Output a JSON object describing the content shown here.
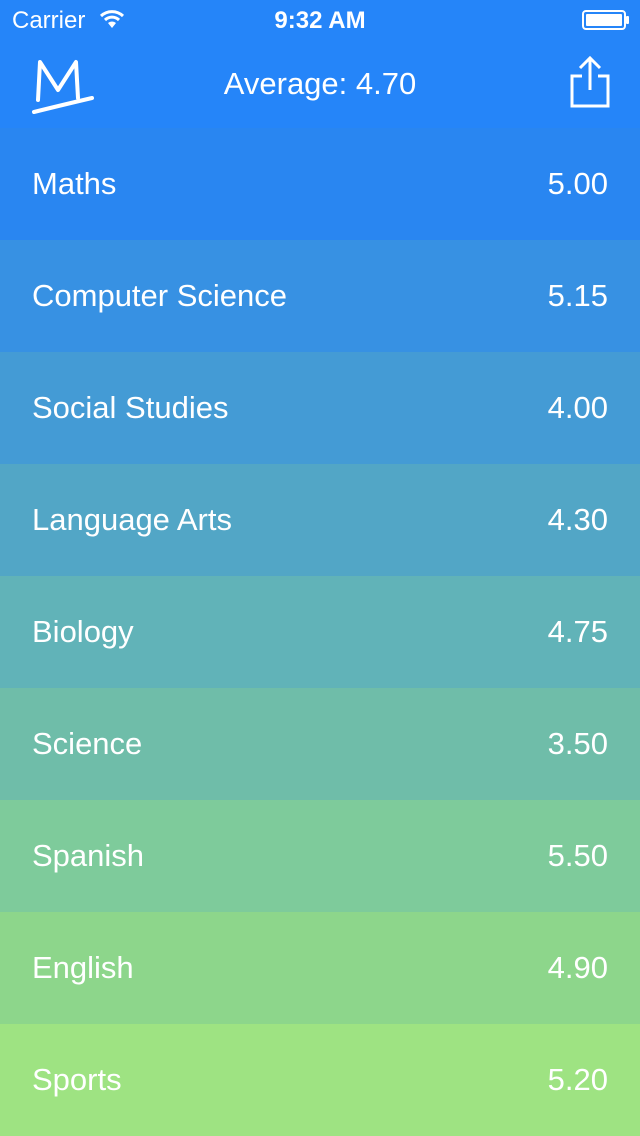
{
  "status_bar": {
    "carrier": "Carrier",
    "time": "9:32 AM",
    "wifi_icon": "wifi-icon",
    "battery_icon": "battery-icon"
  },
  "nav": {
    "logo_icon": "m-logo-icon",
    "average_text": "Average: 4.70",
    "share_icon": "share-icon"
  },
  "colors": {
    "header": "#2585f9",
    "rows": [
      "#2986f1",
      "#3791e3",
      "#449bd5",
      "#52a6c6",
      "#61b3b8",
      "#6fbda9",
      "#7ecb9b",
      "#8dd68b",
      "#9ee382"
    ]
  },
  "subjects": [
    {
      "name": "Maths",
      "grade": "5.00"
    },
    {
      "name": "Computer Science",
      "grade": "5.15"
    },
    {
      "name": "Social Studies",
      "grade": "4.00"
    },
    {
      "name": "Language Arts",
      "grade": "4.30"
    },
    {
      "name": "Biology",
      "grade": "4.75"
    },
    {
      "name": "Science",
      "grade": "3.50"
    },
    {
      "name": "Spanish",
      "grade": "5.50"
    },
    {
      "name": "English",
      "grade": "4.90"
    },
    {
      "name": "Sports",
      "grade": "5.20"
    }
  ]
}
